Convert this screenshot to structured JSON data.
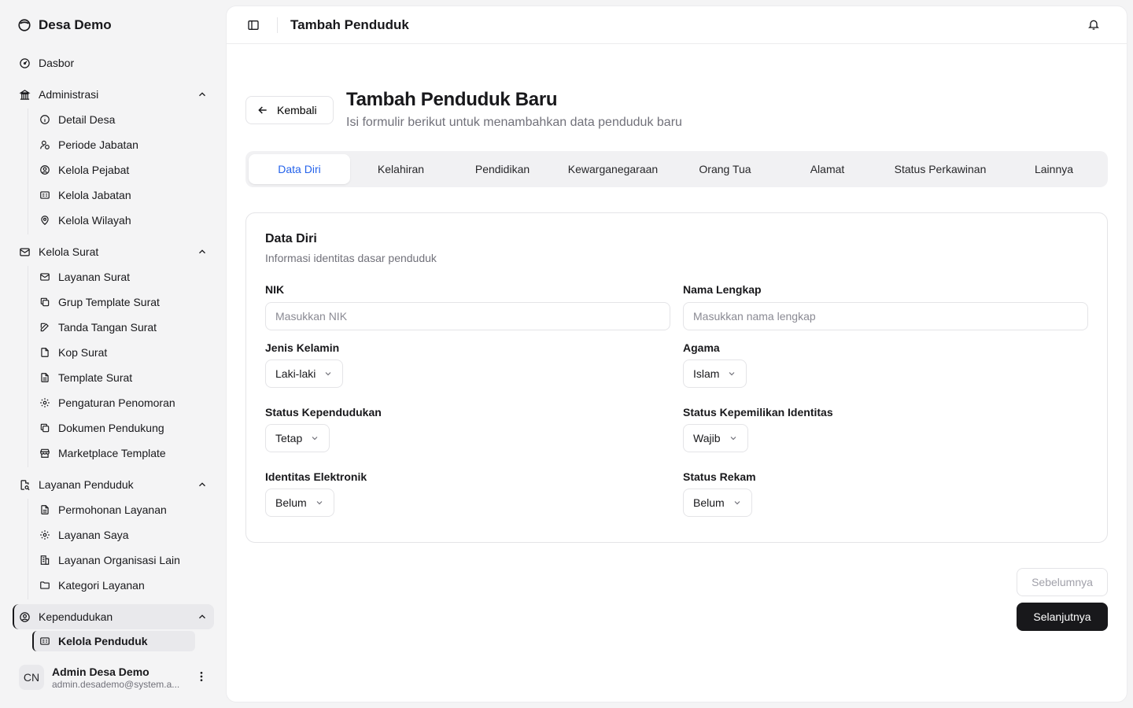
{
  "brand": {
    "name": "Desa Demo"
  },
  "sidebar": {
    "dashboard": "Dasbor",
    "administrasi": {
      "label": "Administrasi",
      "items": [
        "Detail Desa",
        "Periode Jabatan",
        "Kelola Pejabat",
        "Kelola Jabatan",
        "Kelola Wilayah"
      ]
    },
    "kelola_surat": {
      "label": "Kelola Surat",
      "items": [
        "Layanan Surat",
        "Grup Template Surat",
        "Tanda Tangan Surat",
        "Kop Surat",
        "Template Surat",
        "Pengaturan Penomoran",
        "Dokumen Pendukung",
        "Marketplace Template"
      ]
    },
    "layanan_penduduk": {
      "label": "Layanan Penduduk",
      "items": [
        "Permohonan Layanan",
        "Layanan Saya",
        "Layanan Organisasi Lain",
        "Kategori Layanan"
      ]
    },
    "kependudukan": {
      "label": "Kependudukan",
      "items": [
        "Kelola Penduduk"
      ]
    }
  },
  "user": {
    "initials": "CN",
    "name": "Admin Desa Demo",
    "email": "admin.desademo@system.a..."
  },
  "topbar": {
    "title": "Tambah Penduduk"
  },
  "page": {
    "back_label": "Kembali",
    "title": "Tambah Penduduk Baru",
    "subtitle": "Isi formulir berikut untuk menambahkan data penduduk baru"
  },
  "tabs": [
    "Data Diri",
    "Kelahiran",
    "Pendidikan",
    "Kewarganegaraan",
    "Orang Tua",
    "Alamat",
    "Status Perkawinan",
    "Lainnya"
  ],
  "active_tab": "Data Diri",
  "form": {
    "title": "Data Diri",
    "subtitle": "Informasi identitas dasar penduduk",
    "nik": {
      "label": "NIK",
      "value": "",
      "placeholder": "Masukkan NIK"
    },
    "nama": {
      "label": "Nama Lengkap",
      "value": "",
      "placeholder": "Masukkan nama lengkap"
    },
    "jenis_kelamin": {
      "label": "Jenis Kelamin",
      "value": "Laki-laki"
    },
    "agama": {
      "label": "Agama",
      "value": "Islam"
    },
    "status_kependudukan": {
      "label": "Status Kependudukan",
      "value": "Tetap"
    },
    "status_kepemilikan": {
      "label": "Status Kepemilikan Identitas",
      "value": "Wajib"
    },
    "identitas_elektronik": {
      "label": "Identitas Elektronik",
      "value": "Belum"
    },
    "status_rekam": {
      "label": "Status Rekam",
      "value": "Belum"
    }
  },
  "footer": {
    "prev_label": "Sebelumnya",
    "next_label": "Selanjutnya"
  },
  "colors": {
    "accent": "#2563eb",
    "primary": "#18181b",
    "muted": "#71717a",
    "border": "#e4e4e7"
  }
}
